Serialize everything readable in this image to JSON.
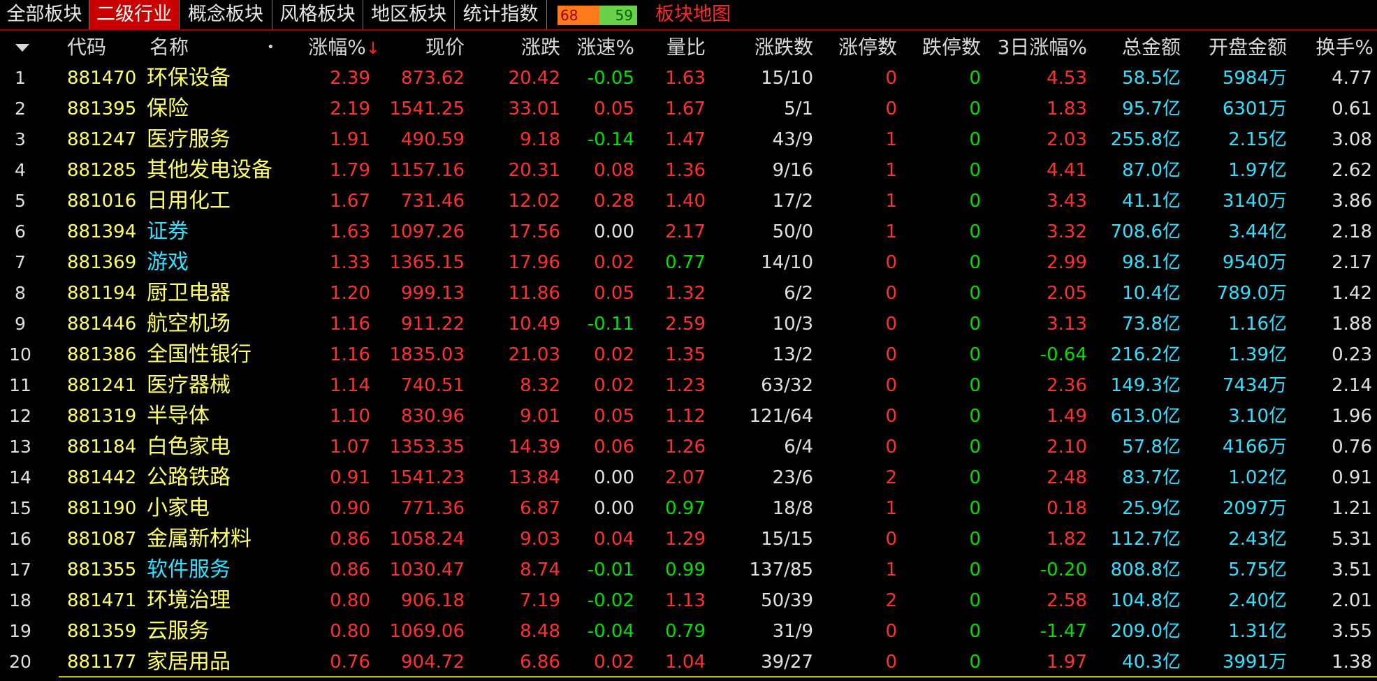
{
  "tabs": [
    {
      "label": "全部板块",
      "active": false
    },
    {
      "label": "二级行业",
      "active": true
    },
    {
      "label": "概念板块",
      "active": false
    },
    {
      "label": "风格板块",
      "active": false
    },
    {
      "label": "地区板块",
      "active": false
    },
    {
      "label": "统计指数",
      "active": false
    }
  ],
  "ratio": {
    "up": "68",
    "down": "59",
    "up_color": "#ff7a1c",
    "down_color": "#6ad04a"
  },
  "map_link": "板块地图",
  "header": {
    "dropdown_icon": "triangle-down-icon",
    "code": "代码",
    "name": "名称",
    "dot": "•",
    "pct": "涨幅%",
    "sort_icon": "↓",
    "price": "现价",
    "change": "涨跌",
    "speed": "涨速%",
    "volume_ratio": "量比",
    "updown": "涨跌数",
    "limit_up": "涨停数",
    "limit_down": "跌停数",
    "d3": "3日涨幅%",
    "amount": "总金额",
    "open_amount": "开盘金额",
    "turnover": "换手%"
  },
  "colors": {
    "up": "#ff3030",
    "down": "#00e000",
    "flat": "#e0e0e0",
    "code": "#ffff66",
    "cyan": "#33e0ff"
  },
  "rows": [
    {
      "idx": "1",
      "code": "881470",
      "name": "环保设备",
      "pct": "2.39",
      "price": "873.62",
      "chg": "20.42",
      "speed": "-0.05",
      "vr": "1.63",
      "ud": "15/10",
      "lu": "0",
      "ld": "0",
      "d3": "4.53",
      "amt": "58.5亿",
      "open": "5984万",
      "turn": "4.77"
    },
    {
      "idx": "2",
      "code": "881395",
      "name": "保险",
      "pct": "2.19",
      "price": "1541.25",
      "chg": "33.01",
      "speed": "0.05",
      "vr": "1.67",
      "ud": "5/1",
      "lu": "0",
      "ld": "0",
      "d3": "1.83",
      "amt": "95.7亿",
      "open": "6301万",
      "turn": "0.61"
    },
    {
      "idx": "3",
      "code": "881247",
      "name": "医疗服务",
      "pct": "1.91",
      "price": "490.59",
      "chg": "9.18",
      "speed": "-0.14",
      "vr": "1.47",
      "ud": "43/9",
      "lu": "1",
      "ld": "0",
      "d3": "2.03",
      "amt": "255.8亿",
      "open": "2.15亿",
      "turn": "3.08"
    },
    {
      "idx": "4",
      "code": "881285",
      "name": "其他发电设备",
      "pct": "1.79",
      "price": "1157.16",
      "chg": "20.31",
      "speed": "0.08",
      "vr": "1.36",
      "ud": "9/16",
      "lu": "1",
      "ld": "0",
      "d3": "4.41",
      "amt": "87.0亿",
      "open": "1.97亿",
      "turn": "2.62"
    },
    {
      "idx": "5",
      "code": "881016",
      "name": "日用化工",
      "pct": "1.67",
      "price": "731.46",
      "chg": "12.02",
      "speed": "0.28",
      "vr": "1.40",
      "ud": "17/2",
      "lu": "1",
      "ld": "0",
      "d3": "3.43",
      "amt": "41.1亿",
      "open": "3140万",
      "turn": "3.86"
    },
    {
      "idx": "6",
      "code": "881394",
      "name": "证券",
      "cyan": true,
      "pct": "1.63",
      "price": "1097.26",
      "chg": "17.56",
      "speed": "0.00",
      "vr": "2.17",
      "ud": "50/0",
      "lu": "1",
      "ld": "0",
      "d3": "3.32",
      "amt": "708.6亿",
      "open": "3.44亿",
      "turn": "2.18"
    },
    {
      "idx": "7",
      "code": "881369",
      "name": "游戏",
      "cyan": true,
      "pct": "1.33",
      "price": "1365.15",
      "chg": "17.96",
      "speed": "0.02",
      "vr": "0.77",
      "ud": "14/10",
      "lu": "0",
      "ld": "0",
      "d3": "2.99",
      "amt": "98.1亿",
      "open": "9540万",
      "turn": "2.17"
    },
    {
      "idx": "8",
      "code": "881194",
      "name": "厨卫电器",
      "pct": "1.20",
      "price": "999.13",
      "chg": "11.86",
      "speed": "0.05",
      "vr": "1.32",
      "ud": "6/2",
      "lu": "0",
      "ld": "0",
      "d3": "2.05",
      "amt": "10.4亿",
      "open": "789.0万",
      "turn": "1.42"
    },
    {
      "idx": "9",
      "code": "881446",
      "name": "航空机场",
      "pct": "1.16",
      "price": "911.22",
      "chg": "10.49",
      "speed": "-0.11",
      "vr": "2.59",
      "ud": "10/3",
      "lu": "0",
      "ld": "0",
      "d3": "3.13",
      "amt": "73.8亿",
      "open": "1.16亿",
      "turn": "1.88"
    },
    {
      "idx": "10",
      "code": "881386",
      "name": "全国性银行",
      "pct": "1.16",
      "price": "1835.03",
      "chg": "21.03",
      "speed": "0.02",
      "vr": "1.35",
      "ud": "13/2",
      "lu": "0",
      "ld": "0",
      "d3": "-0.64",
      "amt": "216.2亿",
      "open": "1.39亿",
      "turn": "0.23"
    },
    {
      "idx": "11",
      "code": "881241",
      "name": "医疗器械",
      "pct": "1.14",
      "price": "740.51",
      "chg": "8.32",
      "speed": "0.02",
      "vr": "1.23",
      "ud": "63/32",
      "lu": "0",
      "ld": "0",
      "d3": "2.36",
      "amt": "149.3亿",
      "open": "7434万",
      "turn": "2.14"
    },
    {
      "idx": "12",
      "code": "881319",
      "name": "半导体",
      "pct": "1.10",
      "price": "830.96",
      "chg": "9.01",
      "speed": "0.05",
      "vr": "1.12",
      "ud": "121/64",
      "lu": "0",
      "ld": "0",
      "d3": "1.49",
      "amt": "613.0亿",
      "open": "3.10亿",
      "turn": "1.96"
    },
    {
      "idx": "13",
      "code": "881184",
      "name": "白色家电",
      "pct": "1.07",
      "price": "1353.35",
      "chg": "14.39",
      "speed": "0.06",
      "vr": "1.26",
      "ud": "6/4",
      "lu": "0",
      "ld": "0",
      "d3": "2.10",
      "amt": "57.8亿",
      "open": "4166万",
      "turn": "0.76"
    },
    {
      "idx": "14",
      "code": "881442",
      "name": "公路铁路",
      "pct": "0.91",
      "price": "1541.23",
      "chg": "13.84",
      "speed": "0.00",
      "vr": "2.07",
      "ud": "23/6",
      "lu": "2",
      "ld": "0",
      "d3": "2.48",
      "amt": "83.7亿",
      "open": "1.02亿",
      "turn": "0.91"
    },
    {
      "idx": "15",
      "code": "881190",
      "name": "小家电",
      "pct": "0.90",
      "price": "771.36",
      "chg": "6.87",
      "speed": "0.00",
      "vr": "0.97",
      "ud": "18/8",
      "lu": "1",
      "ld": "0",
      "d3": "0.18",
      "amt": "25.9亿",
      "open": "2097万",
      "turn": "1.21"
    },
    {
      "idx": "16",
      "code": "881087",
      "name": "金属新材料",
      "pct": "0.86",
      "price": "1058.24",
      "chg": "9.03",
      "speed": "0.04",
      "vr": "1.29",
      "ud": "15/15",
      "lu": "0",
      "ld": "0",
      "d3": "1.82",
      "amt": "112.7亿",
      "open": "2.43亿",
      "turn": "5.31"
    },
    {
      "idx": "17",
      "code": "881355",
      "name": "软件服务",
      "cyan": true,
      "pct": "0.86",
      "price": "1030.47",
      "chg": "8.74",
      "speed": "-0.01",
      "vr": "0.99",
      "ud": "137/85",
      "lu": "1",
      "ld": "0",
      "d3": "-0.20",
      "amt": "808.8亿",
      "open": "5.75亿",
      "turn": "3.51"
    },
    {
      "idx": "18",
      "code": "881471",
      "name": "环境治理",
      "pct": "0.80",
      "price": "906.18",
      "chg": "7.19",
      "speed": "-0.02",
      "vr": "1.13",
      "ud": "50/39",
      "lu": "2",
      "ld": "0",
      "d3": "2.58",
      "amt": "104.8亿",
      "open": "2.40亿",
      "turn": "2.01"
    },
    {
      "idx": "19",
      "code": "881359",
      "name": "云服务",
      "pct": "0.80",
      "price": "1069.06",
      "chg": "8.48",
      "speed": "-0.04",
      "vr": "0.79",
      "ud": "31/9",
      "lu": "0",
      "ld": "0",
      "d3": "-1.47",
      "amt": "209.0亿",
      "open": "1.31亿",
      "turn": "3.55"
    },
    {
      "idx": "20",
      "code": "881177",
      "name": "家居用品",
      "pct": "0.76",
      "price": "904.72",
      "chg": "6.86",
      "speed": "0.02",
      "vr": "1.04",
      "ud": "39/27",
      "lu": "0",
      "ld": "0",
      "d3": "1.97",
      "amt": "40.3亿",
      "open": "3991万",
      "turn": "1.38"
    }
  ]
}
